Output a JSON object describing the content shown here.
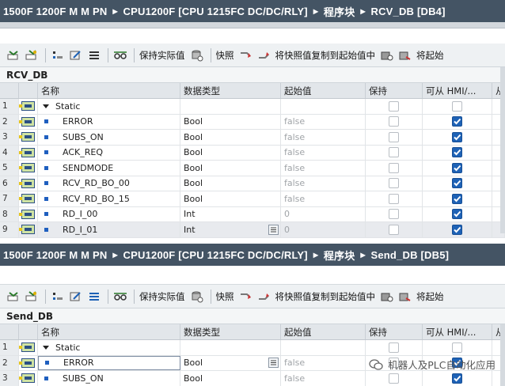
{
  "panel1": {
    "breadcrumb": [
      "1500F 1200F M M PN",
      "CPU1200F [CPU 1215FC DC/DC/RLY]",
      "程序块",
      "RCV_DB [DB4]"
    ],
    "db_title": "RCV_DB",
    "toolbar": {
      "keep_actual": "保持实际值",
      "snapshot": "快照",
      "copy_snapshot": "将快照值复制到起始值中",
      "trailing": "将起始"
    },
    "headers": {
      "name": "名称",
      "type": "数据类型",
      "start": "起始值",
      "retain": "保持",
      "hmi": "可从 HMI/...",
      "more": "从"
    },
    "rows": [
      {
        "num": "1",
        "name": "Static",
        "type": "",
        "start": "",
        "static": true
      },
      {
        "num": "2",
        "name": "ERROR",
        "type": "Bool",
        "start": "false"
      },
      {
        "num": "3",
        "name": "SUBS_ON",
        "type": "Bool",
        "start": "false"
      },
      {
        "num": "4",
        "name": "ACK_REQ",
        "type": "Bool",
        "start": "false"
      },
      {
        "num": "5",
        "name": "SENDMODE",
        "type": "Bool",
        "start": "false"
      },
      {
        "num": "6",
        "name": "RCV_RD_BO_00",
        "type": "Bool",
        "start": "false"
      },
      {
        "num": "7",
        "name": "RCV_RD_BO_15",
        "type": "Bool",
        "start": "false"
      },
      {
        "num": "8",
        "name": "RD_I_00",
        "type": "Int",
        "start": "0"
      },
      {
        "num": "9",
        "name": "RD_I_01",
        "type": "Int",
        "start": "0"
      }
    ]
  },
  "panel2": {
    "breadcrumb": [
      "1500F 1200F M M PN",
      "CPU1200F [CPU 1215FC DC/DC/RLY]",
      "程序块",
      "Send_DB [DB5]"
    ],
    "db_title": "Send_DB",
    "toolbar": {
      "keep_actual": "保持实际值",
      "snapshot": "快照",
      "copy_snapshot": "将快照值复制到起始值中",
      "trailing": "将起始"
    },
    "headers": {
      "name": "名称",
      "type": "数据类型",
      "start": "起始值",
      "retain": "保持",
      "hmi": "可从 HMI/...",
      "more": "从"
    },
    "rows": [
      {
        "num": "1",
        "name": "Static",
        "type": "",
        "start": "",
        "static": true
      },
      {
        "num": "2",
        "name": "ERROR",
        "type": "Bool",
        "start": "false"
      },
      {
        "num": "3",
        "name": "SUBS_ON",
        "type": "Bool",
        "start": "false"
      }
    ]
  },
  "watermark": "机器人及PLC自动化应用",
  "colors": {
    "breadcrumb_bg": "#445464",
    "checkbox_on": "#1e62b6",
    "band": "#d3d8dd"
  }
}
